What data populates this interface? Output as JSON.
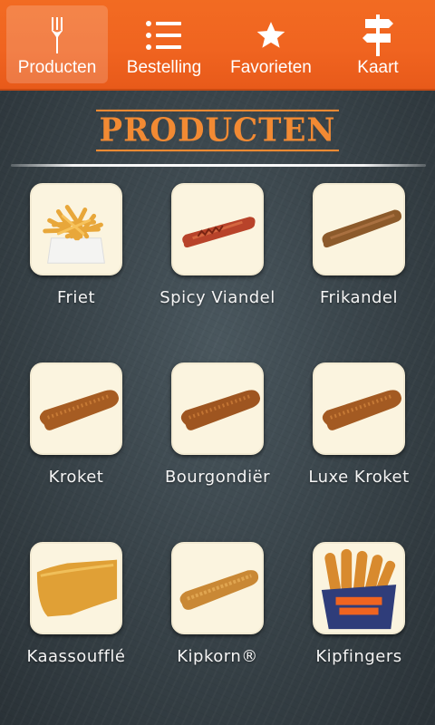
{
  "nav": {
    "tabs": [
      {
        "label": "Producten",
        "icon": "fork-icon",
        "active": true
      },
      {
        "label": "Bestelling",
        "icon": "list-icon",
        "active": false
      },
      {
        "label": "Favorieten",
        "icon": "star-icon",
        "active": false
      },
      {
        "label": "Kaart",
        "icon": "signpost-icon",
        "active": false
      }
    ]
  },
  "page": {
    "title": "PRODUCTEN"
  },
  "products": [
    {
      "name": "Friet",
      "image": "fries"
    },
    {
      "name": "Spicy Viandel",
      "image": "spicy-viandel"
    },
    {
      "name": "Frikandel",
      "image": "frikandel"
    },
    {
      "name": "Kroket",
      "image": "kroket"
    },
    {
      "name": "Bourgondiër",
      "image": "kroket"
    },
    {
      "name": "Luxe Kroket",
      "image": "kroket"
    },
    {
      "name": "Kaassoufflé",
      "image": "kaassouffle"
    },
    {
      "name": "Kipkorn®",
      "image": "kipkorn"
    },
    {
      "name": "Kipfingers",
      "image": "kipfingers"
    }
  ],
  "colors": {
    "accent": "#f06420",
    "title": "#f28a33",
    "board": "#3a454b"
  }
}
